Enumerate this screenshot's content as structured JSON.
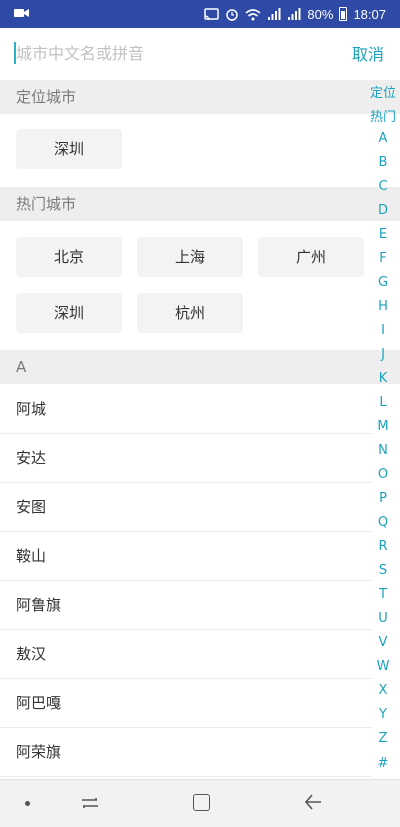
{
  "status_bar": {
    "battery": "80%",
    "time": "18:07",
    "icons": [
      "video-icon",
      "cast-icon",
      "alarm-icon",
      "wifi-icon",
      "signal-icon",
      "signal-icon",
      "battery-icon"
    ]
  },
  "search": {
    "placeholder": "城市中文名或拼音",
    "cancel_label": "取消"
  },
  "location_section": {
    "title": "定位城市",
    "city": "深圳"
  },
  "hot_section": {
    "title": "热门城市",
    "cities": [
      "北京",
      "上海",
      "广州",
      "深圳",
      "杭州"
    ]
  },
  "letter_section": {
    "title": "A",
    "cities": [
      "阿城",
      "安达",
      "安图",
      "鞍山",
      "阿鲁旗",
      "敖汉",
      "阿巴嘎",
      "阿荣旗"
    ]
  },
  "index_bar": {
    "items": [
      "定位",
      "热门",
      "A",
      "B",
      "C",
      "D",
      "E",
      "F",
      "G",
      "H",
      "I",
      "J",
      "K",
      "L",
      "M",
      "N",
      "O",
      "P",
      "Q",
      "R",
      "S",
      "T",
      "U",
      "V",
      "W",
      "X",
      "Y",
      "Z",
      "#"
    ]
  },
  "colors": {
    "accent": "#1aa3bd",
    "status_bar": "#2f4aa6"
  }
}
